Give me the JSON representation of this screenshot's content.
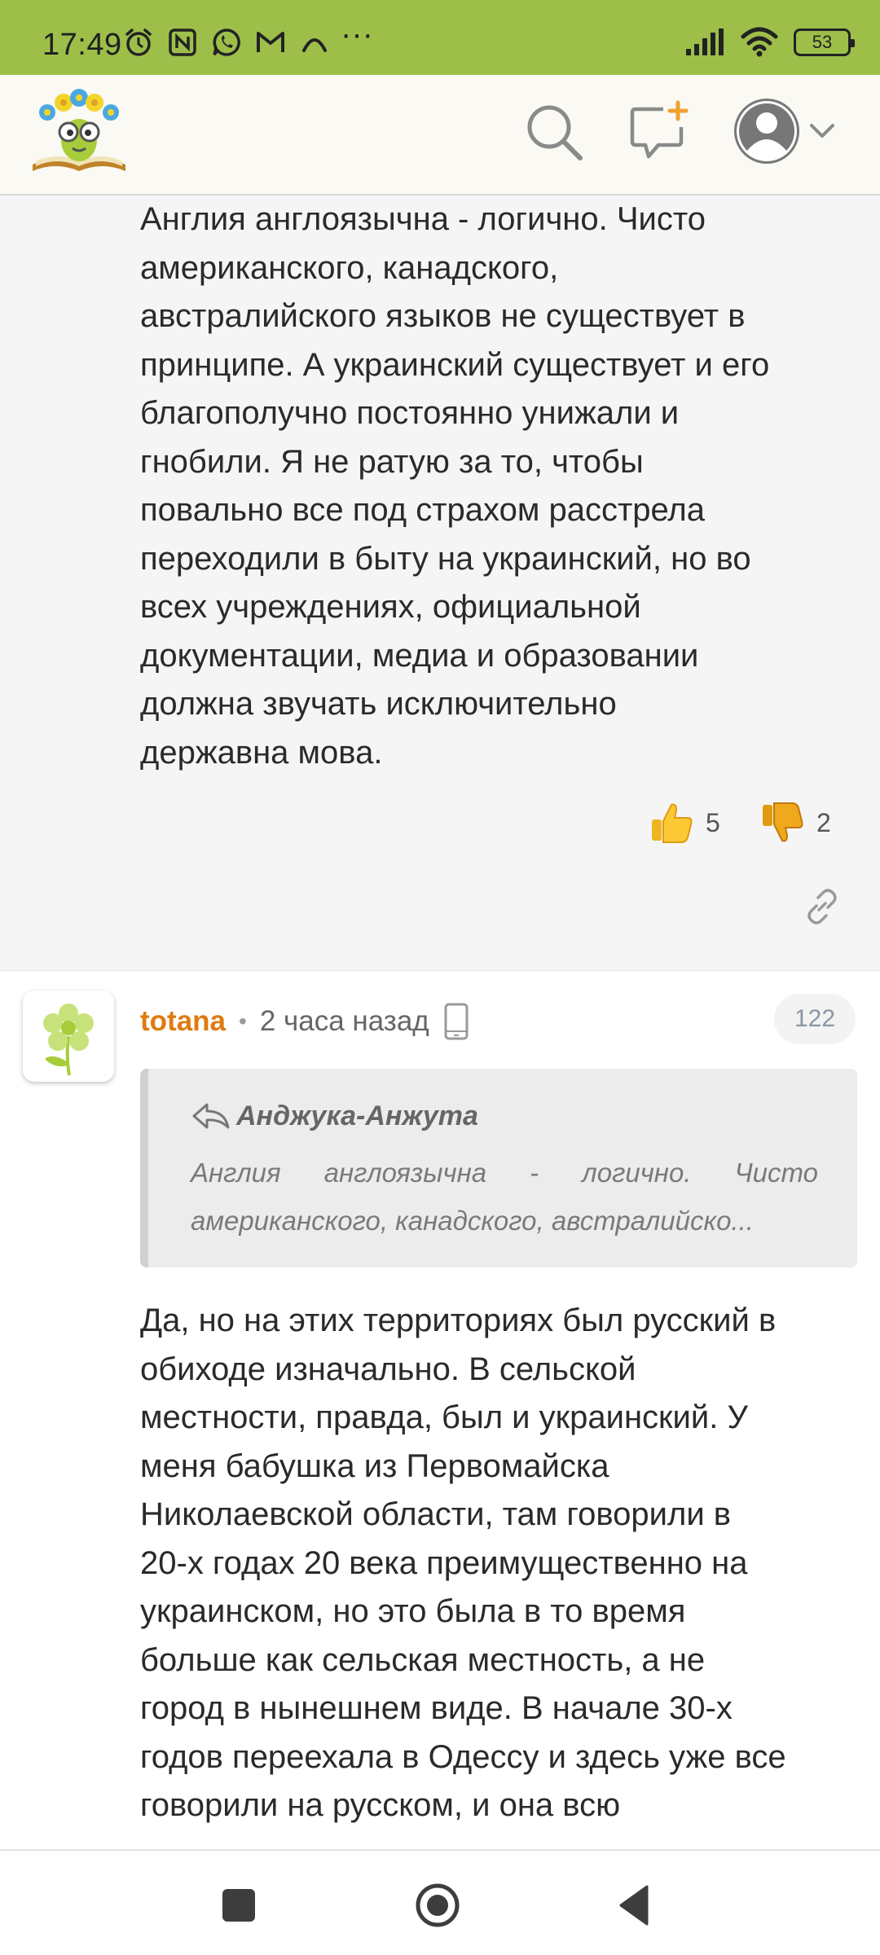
{
  "status_bar": {
    "time": "17:49",
    "battery": "53",
    "icons": [
      "alarm-icon",
      "nfc-icon",
      "whatsapp-icon",
      "gmail-icon",
      "arc-icon",
      "more-dots-icon",
      "signal-icon",
      "wifi-icon",
      "battery-icon"
    ],
    "dots": "···"
  },
  "header": {
    "icons": [
      "site-logo",
      "search-icon",
      "new-post-icon",
      "user-avatar-icon",
      "chevron-down-icon"
    ],
    "colors": {
      "background": "#faf9f3",
      "status_bar": "#9dbf4a"
    }
  },
  "comment1": {
    "lines": [
      "Англия англоязычна - логично. Чисто",
      "американского, канадского,",
      "австралийского языков не существует в",
      "принципе. А украинский существует и его",
      "благополучно постоянно унижали и",
      "гнобили. Я не ратую за то, чтобы",
      "повально все под страхом расстрела",
      "переходили в быту на украинский, но во",
      "всех учреждениях, официальной",
      "документации, медиа и образовании",
      "должна звучать исключительно",
      "державна мова."
    ],
    "likes": "5",
    "dislikes": "2"
  },
  "comment2": {
    "username": "totana",
    "separator": "•",
    "time_ago": "2 часа назад",
    "comment_id": "122",
    "quote": {
      "author": "Анджука-Анжута",
      "text_line1": "Англия англоязычна - логично. Чисто",
      "text_line2": "американского, канадского, австралийско..."
    },
    "lines": [
      "Да, но на этих территориях был русский в",
      "обиходе изначально. В сельской",
      "местности, правда, был и украинский. У",
      "меня бабушка из Первомайска",
      "Николаевской области, там говорили в",
      "20-х годах 20 века преимущественно на",
      "украинском, но это была в то время",
      "больше как сельская местность, а не",
      "город в нынешнем виде. В начале 30-х",
      "годов переехала в Одессу и здесь уже все",
      "говорили на русском, и она всю"
    ],
    "colors": {
      "username": "#e07b10"
    }
  },
  "nav": {
    "icons": [
      "recents-square-icon",
      "home-circle-icon",
      "back-triangle-icon"
    ]
  }
}
